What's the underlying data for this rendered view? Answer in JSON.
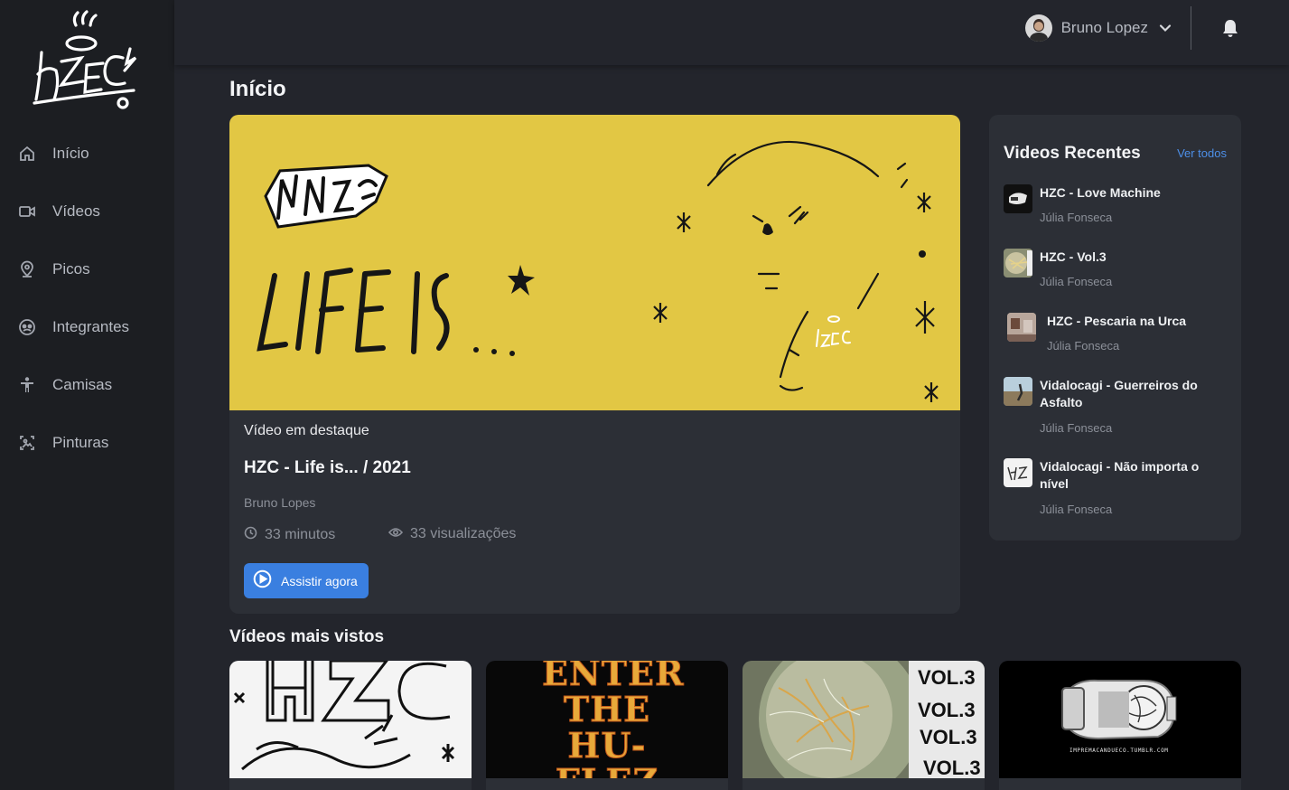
{
  "app": {
    "logo_text": "HZC"
  },
  "sidebar": {
    "items": [
      {
        "label": "Início",
        "icon": "home-icon"
      },
      {
        "label": "Vídeos",
        "icon": "video-camera-icon"
      },
      {
        "label": "Picos",
        "icon": "map-pin-icon"
      },
      {
        "label": "Integrantes",
        "icon": "group-icon"
      },
      {
        "label": "Camisas",
        "icon": "person-icon"
      },
      {
        "label": "Pinturas",
        "icon": "image-icon"
      }
    ]
  },
  "topbar": {
    "user_name": "Bruno Lopez",
    "avatar_icon": "avatar-photo",
    "dropdown_icon": "chevron-down-icon",
    "notifications_icon": "bell-icon"
  },
  "main": {
    "page_title": "Início",
    "featured": {
      "kicker": "Vídeo em destaque",
      "title": "HZC - Life is... / 2021",
      "author": "Bruno Lopes",
      "duration": "33 minutos",
      "views": "33 visualizações",
      "watch_label": "Assistir agora",
      "thumb_text": "LIFE IS ..."
    },
    "recent": {
      "title": "Videos Recentes",
      "see_all": "Ver todos",
      "items": [
        {
          "title": "HZC - Love Machine",
          "author": "Júlia Fonseca"
        },
        {
          "title": "HZC - Vol.3",
          "author": "Júlia Fonseca"
        },
        {
          "title": "HZC - Pescaria na Urca",
          "author": "Júlia Fonseca"
        },
        {
          "title": "Vidalocagi - Guerreiros do Asfalto",
          "author": "Júlia Fonseca"
        },
        {
          "title": "Vidalocagi - Não importa o nível",
          "author": "Júlia Fonseca"
        }
      ]
    },
    "most_viewed": {
      "title": "Vídeos mais vistos",
      "cards": [
        {
          "thumb_text": "HZC"
        },
        {
          "thumb_text": "ENTER THE HU-FLEZ"
        },
        {
          "thumb_text": "VOL.3"
        },
        {
          "thumb_text": "IMPREMACANDUECO.TUMBLR.COM"
        }
      ]
    }
  },
  "colors": {
    "background": "#23252c",
    "sidebar": "#1c1e22",
    "card": "#2c2f36",
    "accent": "#3a7fe0",
    "featured_thumb": "#e2c744"
  }
}
